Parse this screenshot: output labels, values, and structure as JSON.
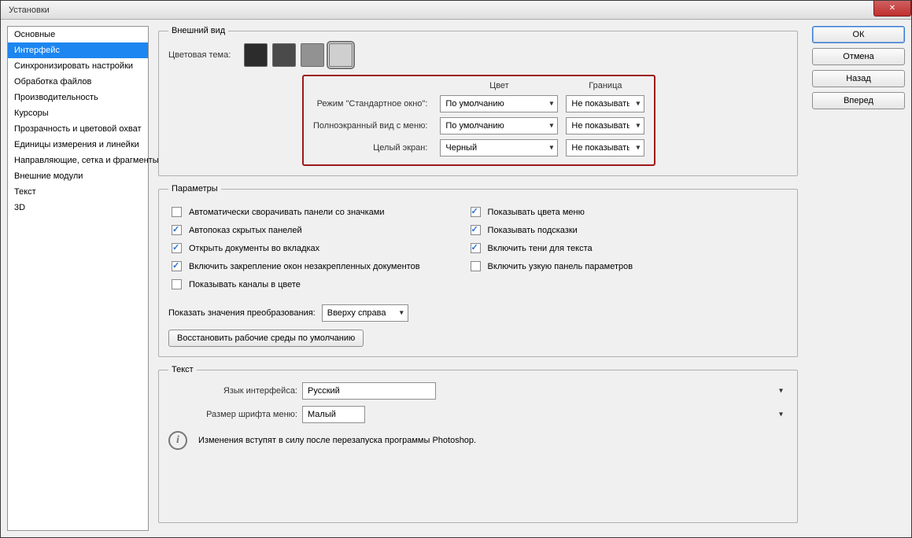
{
  "window": {
    "title": "Установки"
  },
  "sidebar": {
    "items": [
      "Основные",
      "Интерфейс",
      "Синхронизировать настройки",
      "Обработка файлов",
      "Производительность",
      "Курсоры",
      "Прозрачность и цветовой охват",
      "Единицы измерения и линейки",
      "Направляющие, сетка и фрагменты",
      "Внешние модули",
      "Текст",
      "3D"
    ],
    "selected_index": 1
  },
  "buttons": {
    "ok": "ОК",
    "cancel": "Отмена",
    "back": "Назад",
    "forward": "Вперед"
  },
  "appearance": {
    "legend": "Внешний вид",
    "color_theme_label": "Цветовая тема:",
    "swatches": [
      "#2c2c2c",
      "#4a4a4a",
      "#929292",
      "#cfcfcf"
    ],
    "swatch_selected": 3,
    "columns": {
      "color": "Цвет",
      "border": "Граница"
    },
    "rows": [
      {
        "label": "Режим \"Стандартное окно\":",
        "color": "По умолчанию",
        "border": "Не показывать"
      },
      {
        "label": "Полноэкранный вид с меню:",
        "color": "По умолчанию",
        "border": "Не показывать"
      },
      {
        "label": "Целый экран:",
        "color": "Черный",
        "border": "Не показывать"
      }
    ]
  },
  "params": {
    "legend": "Параметры",
    "left": [
      {
        "checked": false,
        "label": "Автоматически сворачивать панели со значками"
      },
      {
        "checked": true,
        "label": "Автопоказ скрытых панелей"
      },
      {
        "checked": true,
        "label": "Открыть документы во вкладках"
      },
      {
        "checked": true,
        "label": "Включить закрепление окон незакрепленных документов"
      },
      {
        "checked": false,
        "label": "Показывать каналы в цвете"
      }
    ],
    "right": [
      {
        "checked": true,
        "label": "Показывать цвета меню"
      },
      {
        "checked": true,
        "label": "Показывать подсказки"
      },
      {
        "checked": true,
        "label": "Включить тени для текста"
      },
      {
        "checked": false,
        "label": "Включить узкую панель параметров"
      }
    ],
    "transform_label": "Показать значения преобразования:",
    "transform_value": "Вверху справа",
    "restore": "Восстановить рабочие среды по умолчанию"
  },
  "text": {
    "legend": "Текст",
    "language_label": "Язык интерфейса:",
    "language_value": "Русский",
    "font_label": "Размер шрифта меню:",
    "font_value": "Малый",
    "notice": "Изменения вступят в силу после перезапуска программы Photoshop."
  }
}
